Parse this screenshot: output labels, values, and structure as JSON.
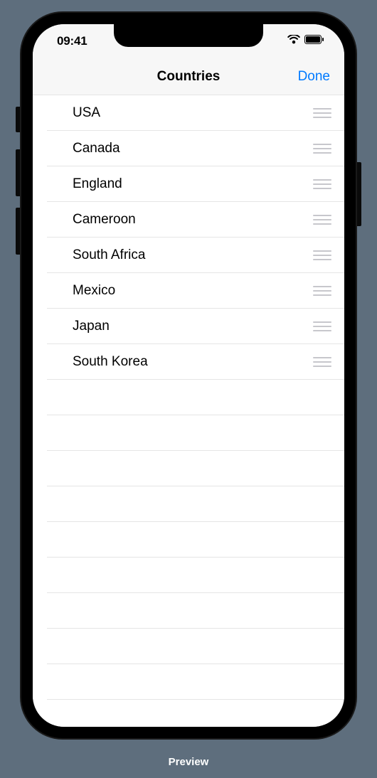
{
  "statusBar": {
    "time": "09:41"
  },
  "navBar": {
    "title": "Countries",
    "done": "Done"
  },
  "list": {
    "items": [
      {
        "label": "USA"
      },
      {
        "label": "Canada"
      },
      {
        "label": "England"
      },
      {
        "label": "Cameroon"
      },
      {
        "label": "South Africa"
      },
      {
        "label": "Mexico"
      },
      {
        "label": "Japan"
      },
      {
        "label": "South Korea"
      }
    ]
  },
  "footer": {
    "preview": "Preview"
  }
}
